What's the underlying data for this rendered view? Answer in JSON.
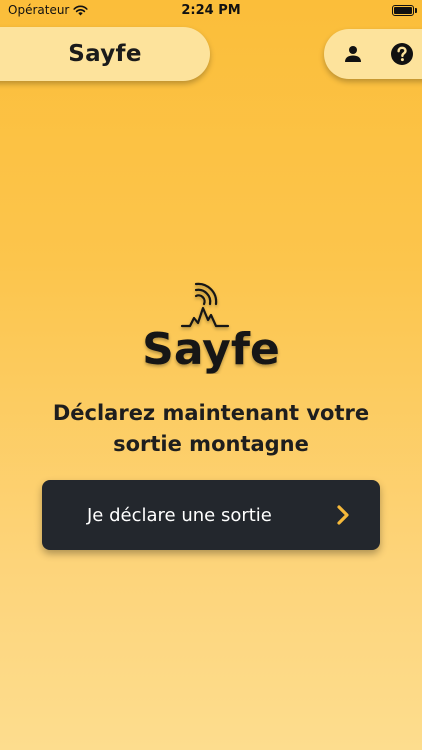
{
  "status_bar": {
    "carrier": "Opérateur",
    "time": "2:24 PM"
  },
  "header": {
    "title": "Sayfe",
    "icons": [
      "user-icon",
      "help-icon"
    ]
  },
  "logo": {
    "text": "Sayfe"
  },
  "main": {
    "headline_line1": "Déclarez maintenant votre",
    "headline_line2": "sortie montagne",
    "cta_label": "Je déclare une sortie"
  },
  "colors": {
    "background_top": "#fbbe3a",
    "background_bottom": "#fddd8e",
    "pill": "#fde39c",
    "button": "#23272d",
    "accent": "#f6b93a"
  }
}
